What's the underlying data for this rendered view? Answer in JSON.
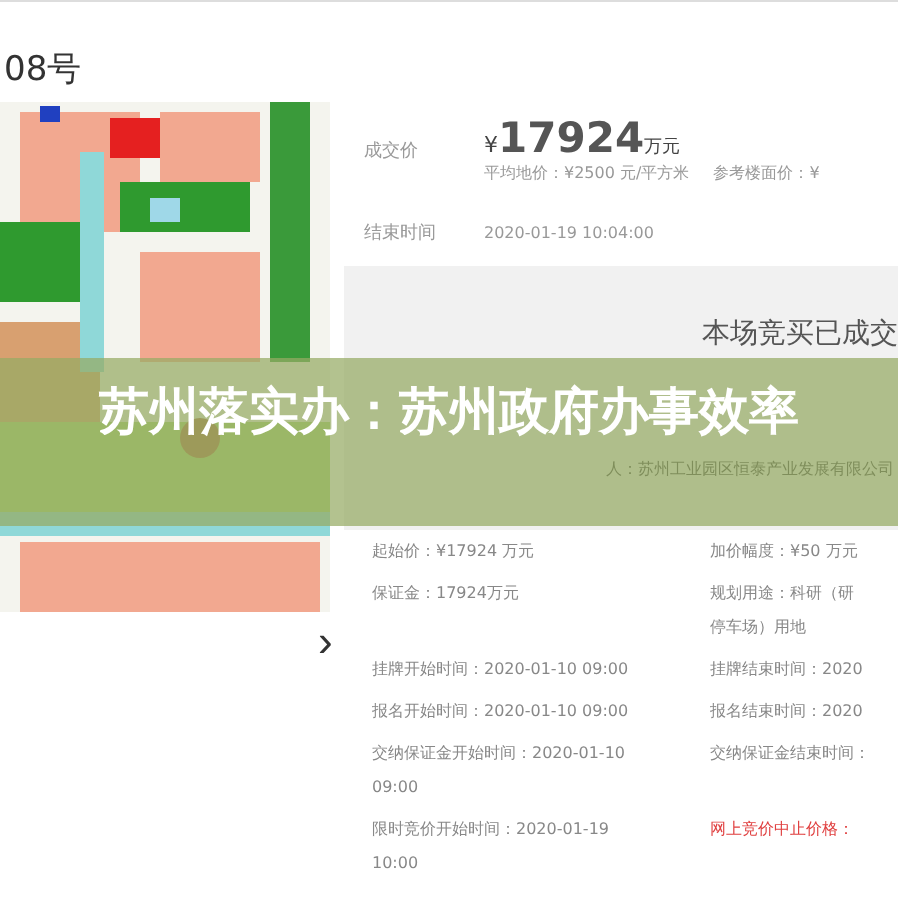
{
  "header": {
    "title": "08号"
  },
  "deal": {
    "price_label": "成交价",
    "currency": "¥",
    "price": "17924",
    "unit": "万元",
    "avg_price": "平均地价：¥2500 元/平方米",
    "ref_price": "参考楼面价：¥",
    "end_label": "结束时间",
    "end_time": "2020-01-19 10:04:00"
  },
  "status": {
    "message": "本场竞买已成交",
    "winner": "人：苏州工业园区恒泰产业发展有限公司"
  },
  "banner": {
    "title": "苏州落实办：苏州政府办事效率"
  },
  "gallery": {
    "next": "›"
  },
  "details": [
    {
      "left": "起始价：¥17924 万元",
      "right": "加价幅度：¥50 万元",
      "kind": "plain"
    },
    {
      "left": "保证金：17924万元",
      "right": "规划用途：科研（研",
      "right_more": "停车场）用地",
      "kind": "plain"
    },
    {
      "left": "挂牌开始时间：2020-01-10 09:00",
      "right": "挂牌结束时间：2020",
      "kind": "plain"
    },
    {
      "left": "报名开始时间：2020-01-10 09:00",
      "right": "报名结束时间：2020",
      "kind": "plain"
    },
    {
      "left": "交纳保证金开始时间：2020-01-10\n09:00",
      "right": "交纳保证金结束时间：",
      "kind": "plain"
    },
    {
      "left": "限时竞价开始时间：2020-01-19\n10:00",
      "right": "网上竞价中止价格：",
      "kind": "alert"
    }
  ]
}
